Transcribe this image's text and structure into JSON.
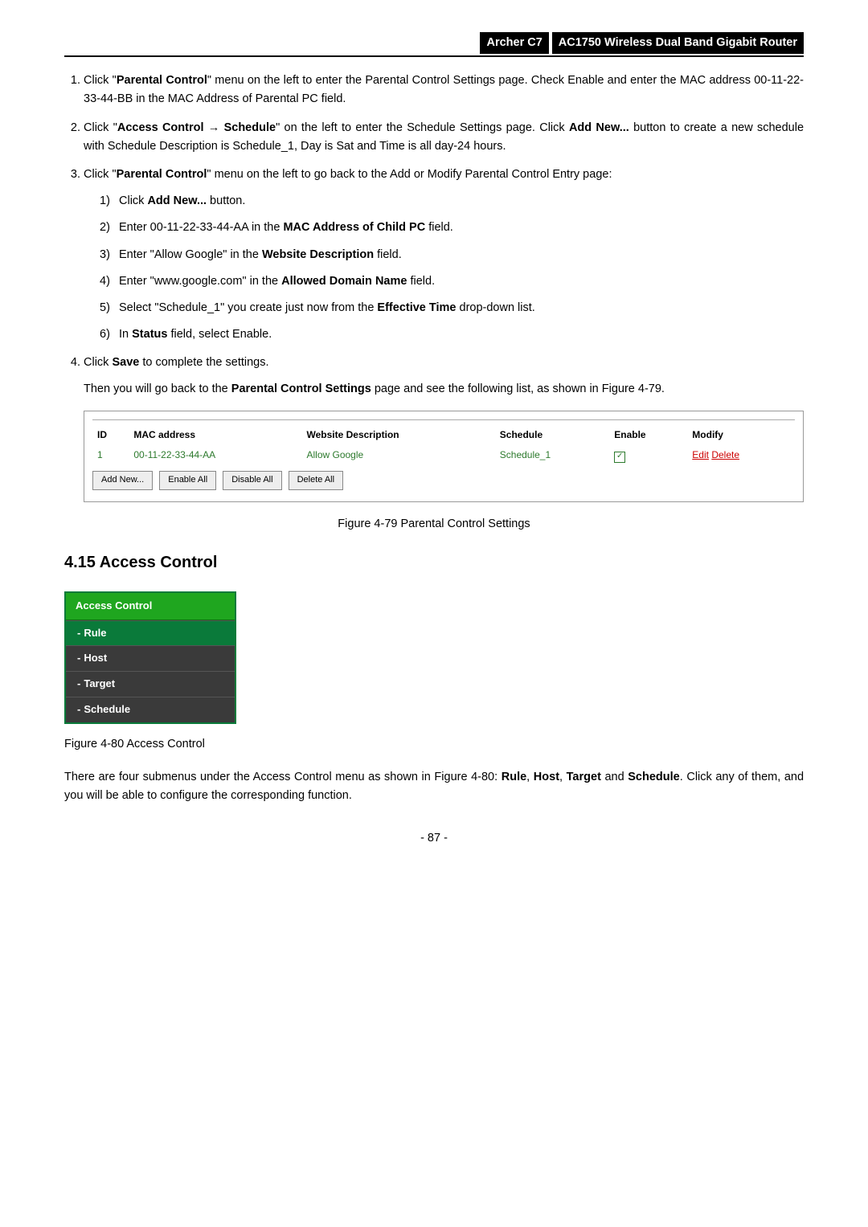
{
  "header": {
    "model": "Archer C7",
    "title": "AC1750 Wireless Dual Band Gigabit Router"
  },
  "step1": {
    "prefix": "Click \"",
    "bold": "Parental Control",
    "rest": "\" menu on the left to enter the Parental Control Settings page. Check Enable and enter the MAC address 00-11-22-33-44-BB in the MAC Address of Parental PC field."
  },
  "step2": {
    "prefix": "Click \"",
    "b1": "Access Control → Schedule",
    "mid": "\" on the left to enter the Schedule Settings page. Click ",
    "b2": "Add New...",
    "rest": " button to create a new schedule with Schedule Description is Schedule_1, Day is Sat and Time is all day-24 hours."
  },
  "step3": {
    "prefix": "Click \"",
    "bold": "Parental Control",
    "rest": "\" menu on the left to go back to the Add or Modify Parental Control Entry page:"
  },
  "sub": {
    "s1": {
      "n": "1)",
      "a": "Click ",
      "b": "Add New...",
      "c": " button."
    },
    "s2": {
      "n": "2)",
      "a": "Enter 00-11-22-33-44-AA in the ",
      "b": "MAC Address of Child PC",
      "c": " field."
    },
    "s3": {
      "n": "3)",
      "a": "Enter \"Allow Google\" in the ",
      "b": "Website Description",
      "c": " field."
    },
    "s4": {
      "n": "4)",
      "a": "Enter \"www.google.com\" in the ",
      "b": "Allowed Domain Name",
      "c": " field."
    },
    "s5": {
      "n": "5)",
      "a": "Select \"Schedule_1\" you create just now from the ",
      "b": "Effective Time",
      "c": " drop-down list."
    },
    "s6": {
      "n": "6)",
      "a": "In ",
      "b": "Status",
      "c": " field, select Enable."
    }
  },
  "step4": {
    "a": "Click ",
    "b": "Save",
    "c": " to complete the settings.",
    "then_a": "Then you will go back to the ",
    "then_b": "Parental Control Settings",
    "then_c": " page and see the following list, as shown in Figure 4-79."
  },
  "table": {
    "headers": {
      "id": "ID",
      "mac": "MAC address",
      "desc": "Website Description",
      "sched": "Schedule",
      "enable": "Enable",
      "modify": "Modify"
    },
    "row": {
      "id": "1",
      "mac": "00-11-22-33-44-AA",
      "desc": "Allow Google",
      "sched": "Schedule_1",
      "edit": "Edit",
      "delete": "Delete"
    },
    "buttons": {
      "add": "Add New...",
      "enableAll": "Enable All",
      "disableAll": "Disable All",
      "deleteAll": "Delete All"
    }
  },
  "fig79": "Figure 4-79 Parental Control Settings",
  "section": "4.15  Access Control",
  "menu": {
    "header": "Access Control",
    "items": [
      {
        "label": "Rule"
      },
      {
        "label": "Host"
      },
      {
        "label": "Target"
      },
      {
        "label": "Schedule"
      }
    ]
  },
  "fig80": "Figure 4-80 Access Control",
  "bodytext": {
    "a": "There are four submenus under the Access Control menu as shown in Figure 4-80: ",
    "b1": "Rule",
    "c1": ", ",
    "b2": "Host",
    "c2": ", ",
    "b3": "Target",
    "c3": " and ",
    "b4": "Schedule",
    "rest": ". Click any of them, and you will be able to configure the corresponding function."
  },
  "pagenum": "- 87 -"
}
